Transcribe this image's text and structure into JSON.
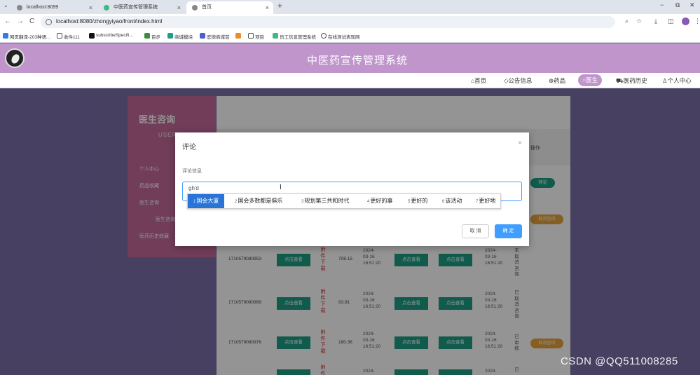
{
  "browser": {
    "tabs": [
      {
        "label": "localhost:8099",
        "active": false
      },
      {
        "label": "中医药宣传管理系统",
        "active": false
      },
      {
        "label": "首页",
        "active": true
      }
    ],
    "new_tab": "+",
    "url": "localhost:8080/zhongyiyao/front/index.html",
    "bookmarks": [
      "网页翻译-203种语...",
      "收件111",
      "subscribeSpecifi...",
      "百步",
      "商城模块",
      "宏德商城首",
      "",
      "项目",
      "员工信息管理系统",
      "在线测试表现网"
    ],
    "window_controls": {
      "minimize": "−",
      "restore": "⧉",
      "close": "✕"
    },
    "nav_controls": {
      "back": "←",
      "forward": "→",
      "reload": "C"
    }
  },
  "site": {
    "title": "中医药宣传管理系统",
    "nav": [
      {
        "label": "首页",
        "icon": "home-icon",
        "active": false
      },
      {
        "label": "公告信息",
        "icon": "tag-icon",
        "active": false
      },
      {
        "label": "药品",
        "icon": "pill-icon",
        "active": false
      },
      {
        "label": "医生",
        "icon": "doctor-icon",
        "active": true
      },
      {
        "label": "医药历史",
        "icon": "car-icon",
        "active": false
      },
      {
        "label": "个人中心",
        "icon": "user-icon",
        "active": false
      }
    ]
  },
  "sidebar": {
    "title": "医生咨询",
    "subtitle": "USER",
    "items": [
      "个人中心",
      "药品收藏",
      "医生咨询",
      "医生咨询",
      "医药历史收藏"
    ]
  },
  "table": {
    "header_op": "操作",
    "rows": [
      {
        "id": "1710579080953",
        "btn1": "点击查看",
        "download": "附件下载",
        "price": "708.15",
        "date": "2024-03-16 16:51:20",
        "btn2": "点击查看",
        "btn3": "点击查看",
        "date2": "2024-03-16 16:51:20",
        "status": "未取消咨询",
        "action": ""
      },
      {
        "id": "1710579080989",
        "btn1": "点击查看",
        "download": "附件下载",
        "price": "83.91",
        "date": "2024-03-16 16:51:20",
        "btn2": "点击查看",
        "btn3": "点击查看",
        "date2": "2024-03-16 16:51:20",
        "status": "已取消咨询",
        "action": ""
      },
      {
        "id": "1710579080976",
        "btn1": "点击查看",
        "download": "附件下载",
        "price": "180.36",
        "date": "2024-03-16 16:51:20",
        "btn2": "点击查看",
        "btn3": "点击查看",
        "date2": "2024-03-16 16:51:20",
        "status": "已审核",
        "action": "取消咨询"
      },
      {
        "id": "",
        "btn1": "点击查看",
        "download": "附件",
        "price": "",
        "date": "2024-",
        "btn2": "点击查看",
        "btn3": "点击查看",
        "date2": "2024-",
        "status": "已",
        "action": ""
      }
    ],
    "first_row_action": "评论",
    "second_row_action": "取消咨询"
  },
  "dialog": {
    "title": "评论",
    "close": "×",
    "label": "评论信息",
    "typed": "gh'd",
    "cancel": "取 消",
    "ok": "确 定"
  },
  "ime": {
    "candidates": [
      {
        "index": "1",
        "text": "国会大厦"
      },
      {
        "index": "2",
        "text": "国会多数都是俱乐"
      },
      {
        "index": "3",
        "text": "规划第三共和时代"
      },
      {
        "index": "4",
        "text": "更好的事"
      },
      {
        "index": "5",
        "text": "更好的"
      },
      {
        "index": "6",
        "text": "该活动"
      },
      {
        "index": "7",
        "text": "更好地"
      }
    ]
  },
  "watermark": "CSDN @QQ511008285"
}
